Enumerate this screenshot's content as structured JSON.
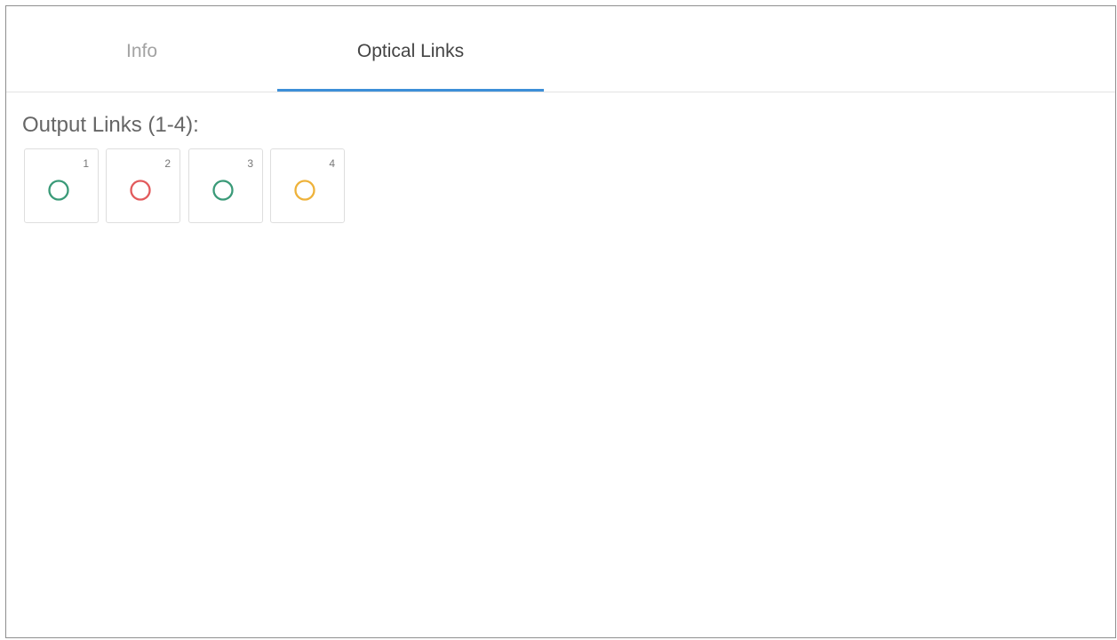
{
  "tabs": {
    "info_label": "Info",
    "optical_links_label": "Optical Links",
    "active": "Optical Links"
  },
  "output_links": {
    "label": "Output Links (1-4):",
    "items": [
      {
        "number": "1",
        "status_color": "#3a9a78"
      },
      {
        "number": "2",
        "status_color": "#e25a5c"
      },
      {
        "number": "3",
        "status_color": "#3a9a78"
      },
      {
        "number": "4",
        "status_color": "#eeb23a"
      }
    ]
  },
  "colors": {
    "accent": "#3d8fd8"
  }
}
